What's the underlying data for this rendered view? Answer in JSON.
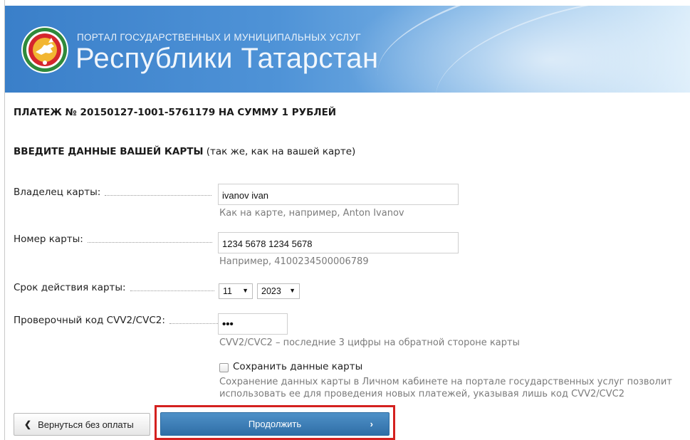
{
  "header": {
    "subtitle": "ПОРТАЛ ГОСУДАРСТВЕННЫХ И МУНИЦИПАЛЬНЫХ УСЛУГ",
    "title": "Республики Татарстан",
    "logo_icon": "tatarstan-emblem-icon"
  },
  "payment": {
    "title": "ПЛАТЕЖ № 20150127-1001-5761179 НА СУММУ 1 РУБЛЕЙ"
  },
  "card_section": {
    "title_bold": "ВВЕДИТЕ ДАННЫЕ ВАШЕЙ КАРТЫ",
    "title_note": " (так же, как на вашей карте)"
  },
  "form": {
    "owner": {
      "label": "Владелец карты:",
      "value": "ivanov ivan",
      "hint": "Как на карте, например, Anton Ivanov"
    },
    "number": {
      "label": "Номер карты:",
      "value": "1234 5678 1234 5678",
      "hint": "Например, 4100234500006789"
    },
    "expiry": {
      "label": "Срок действия карты:",
      "month": "11",
      "year": "2023"
    },
    "cvv": {
      "label": "Проверочный код CVV2/CVC2:",
      "value": "•••",
      "hint": "CVV2/CVC2 – последние 3 цифры на обратной стороне карты"
    },
    "save": {
      "label": "Сохранить данные карты",
      "checked": false,
      "description": "Сохранение данных карты в Личном кабинете на портале государственных услуг позволит использовать ее для проведения новых платежей, указывая лишь код CVV2/CVC2"
    }
  },
  "buttons": {
    "back": "Вернуться без оплаты",
    "continue": "Продолжить"
  },
  "colors": {
    "primary_button": "#3a7db7",
    "highlight": "#d4211f",
    "hint_text": "#7b7b7b"
  }
}
